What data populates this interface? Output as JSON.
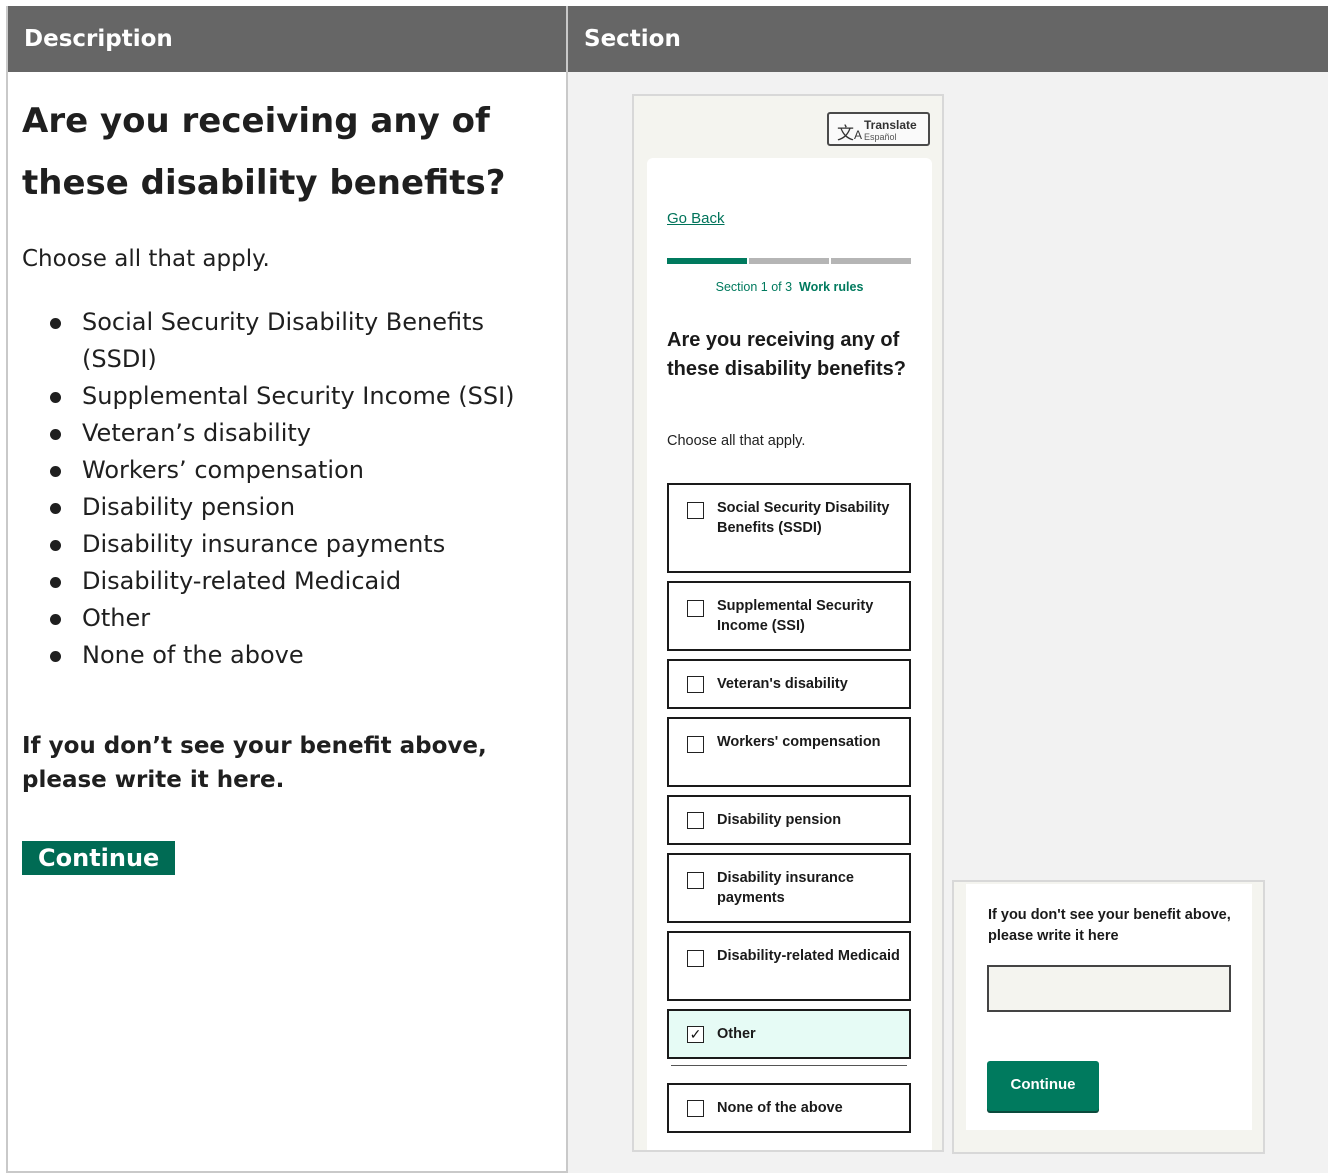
{
  "table": {
    "header_description": "Description",
    "header_section": "Section"
  },
  "description": {
    "title": "Are you receiving any of these disability benefits?",
    "subtitle": "Choose all that apply.",
    "items": [
      "Social Security Disability Benefits (SSDI)",
      "Supplemental Security Income (SSI)",
      "Veteran’s disability",
      "Workers’ compensation",
      "Disability pension",
      "Disability insurance payments",
      "Disability-related Medicaid",
      "Other",
      "None of the above"
    ],
    "write_in_prompt": "If you don’t see your benefit above, please write it here.",
    "continue_label": "Continue"
  },
  "screen": {
    "translate": {
      "label": "Translate",
      "sublabel": "Español",
      "icon": "translate-icon"
    },
    "go_back": "Go Back",
    "progress": {
      "current": 1,
      "total": 3
    },
    "section_prefix": "Section 1 of 3",
    "section_name": "Work rules",
    "question": "Are you receiving any of these disability benefits?",
    "hint": "Choose all that apply.",
    "options": [
      {
        "label": "Social Security Disability Benefits (SSDI)",
        "checked": false
      },
      {
        "label": "Supplemental Security Income (SSI)",
        "checked": false
      },
      {
        "label": "Veteran's disability",
        "checked": false
      },
      {
        "label": "Workers' compensation",
        "checked": false
      },
      {
        "label": "Disability pension",
        "checked": false
      },
      {
        "label": "Disability insurance payments",
        "checked": false
      },
      {
        "label": "Disability-related Medicaid",
        "checked": false
      },
      {
        "label": "Other",
        "checked": true
      },
      {
        "label": "None of the above",
        "checked": false
      }
    ]
  },
  "followup": {
    "question": "If you don't see your benefit above, please write it here",
    "input_value": "",
    "continue_label": "Continue"
  },
  "colors": {
    "header_bg": "#666666",
    "brand_green": "#007a5e",
    "checked_bg": "#e6fbf5"
  }
}
